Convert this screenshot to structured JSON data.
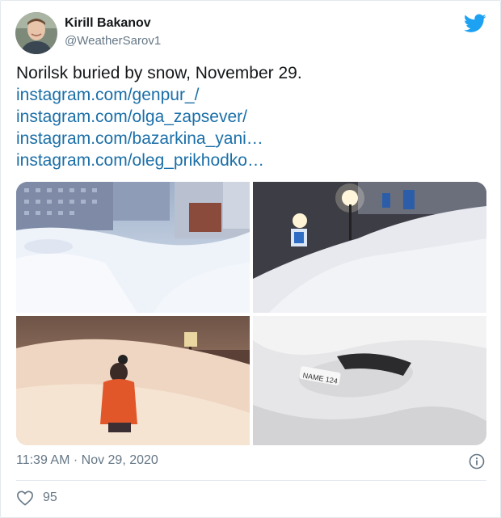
{
  "author": {
    "name": "Kirill Bakanov",
    "handle": "@WeatherSarov1",
    "avatar_icon": "user-avatar"
  },
  "tweet": {
    "text": "Norilsk buried by snow, November 29.",
    "links": [
      "instagram.com/genpur_/",
      "instagram.com/olga_zapsever/",
      "instagram.com/bazarkina_yani…",
      "instagram.com/oleg_prikhodko…"
    ]
  },
  "media": {
    "count": 4,
    "plate_text": "NAME 124"
  },
  "meta": {
    "timestamp": "11:39 AM · Nov 29, 2020"
  },
  "engagement": {
    "likes": "95"
  },
  "colors": {
    "link": "#1b6fa8",
    "twitter_blue": "#1da1f2",
    "secondary_text": "#657786"
  },
  "icons": {
    "brand": "twitter-bird-icon",
    "info": "info-icon",
    "like": "heart-icon"
  }
}
